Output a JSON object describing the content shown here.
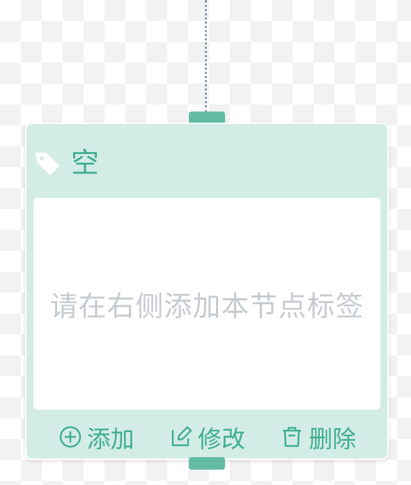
{
  "node": {
    "title": "空",
    "icon": "tag-icon",
    "placeholder": "请在右侧添加本节点标签"
  },
  "actions": {
    "add": {
      "label": "添加",
      "icon": "plus-circle-icon"
    },
    "edit": {
      "label": "修改",
      "icon": "edit-icon"
    },
    "delete": {
      "label": "删除",
      "icon": "trash-icon"
    }
  },
  "colors": {
    "accent": "#3fae8f",
    "port": "#63bba4",
    "card": "#d3ece6",
    "placeholder_text": "#c6cbd1",
    "connector": "#8a9bb5"
  }
}
